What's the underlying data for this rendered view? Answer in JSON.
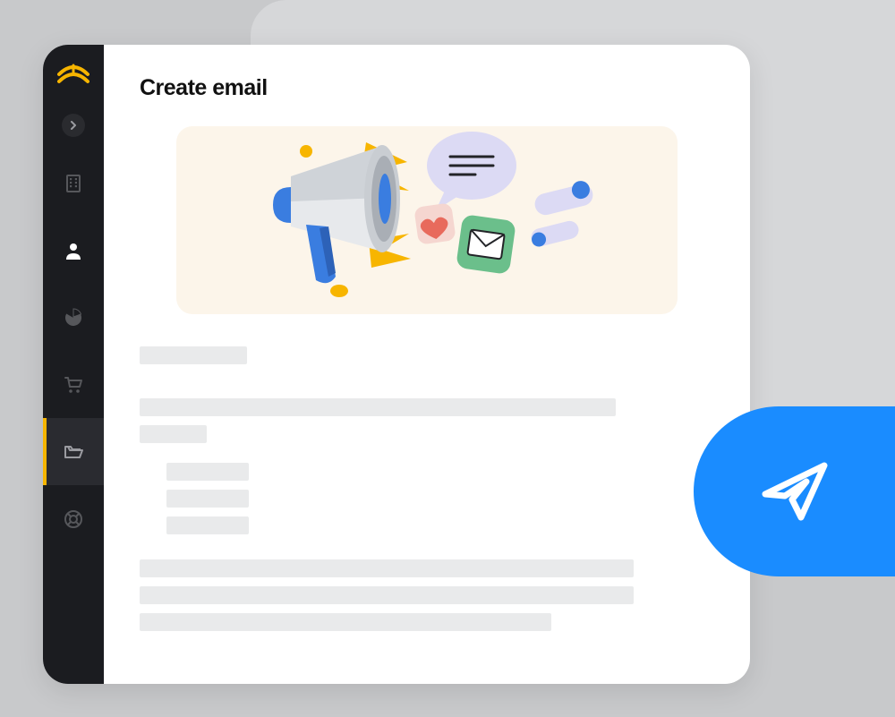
{
  "page": {
    "title": "Create email"
  },
  "sidebar": {
    "logo": "logo",
    "items": [
      {
        "name": "expand",
        "icon": "chevron-right"
      },
      {
        "name": "company",
        "icon": "building"
      },
      {
        "name": "contacts",
        "icon": "person"
      },
      {
        "name": "reports",
        "icon": "pie-chart"
      },
      {
        "name": "commerce",
        "icon": "cart"
      },
      {
        "name": "files",
        "icon": "folder-open",
        "active": true
      },
      {
        "name": "help",
        "icon": "lifebuoy"
      }
    ]
  },
  "colors": {
    "accent": "#1a8cff",
    "brand": "#f7b500",
    "sidebar": "#1b1c20",
    "hero_bg": "#fcf5ea"
  },
  "hero": {
    "elements": [
      "megaphone",
      "speech-bubble",
      "heart",
      "envelope",
      "toggles"
    ]
  },
  "fab": {
    "icon": "paper-plane"
  }
}
